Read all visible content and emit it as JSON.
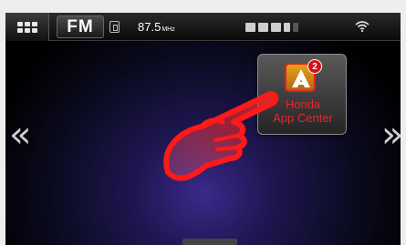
{
  "status_bar": {
    "source_label": "FM",
    "frequency": "87.5",
    "frequency_unit": "MHz"
  },
  "app_tile": {
    "label_line1": "Honda",
    "label_line2": "App Center",
    "badge_count": "2"
  },
  "nav": {
    "left_arrow": "«",
    "right_arrow": "»"
  },
  "colors": {
    "accent": "#e8262b",
    "badge": "#d0121b",
    "app_icon": "#e6a21a"
  }
}
